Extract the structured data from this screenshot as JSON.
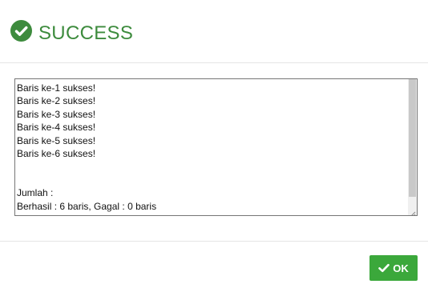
{
  "dialog": {
    "title": "SUCCESS",
    "header_icon": "check-circle-icon",
    "accent_color": "#3d8b3d"
  },
  "log": {
    "lines": [
      "Baris ke-1 sukses!",
      "Baris ke-2 sukses!",
      "Baris ke-3 sukses!",
      "Baris ke-4 sukses!",
      "Baris ke-5 sukses!",
      "Baris ke-6 sukses!"
    ],
    "summary_label": "Jumlah :",
    "summary_text": "Berhasil : 6 baris, Gagal : 0 baris"
  },
  "footer": {
    "ok_label": "OK",
    "ok_icon": "check-icon",
    "ok_color": "#3ba83b"
  }
}
